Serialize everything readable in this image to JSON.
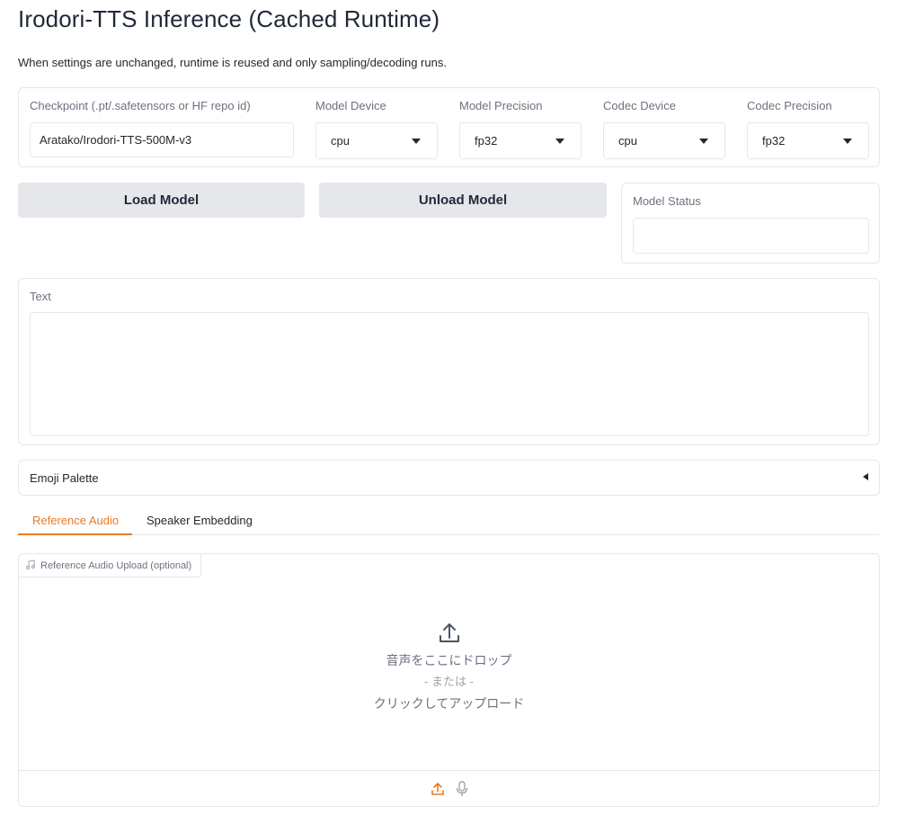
{
  "header": {
    "title": "Irodori-TTS Inference (Cached Runtime)",
    "subtitle": "When settings are unchanged, runtime is reused and only sampling/decoding runs."
  },
  "settings": {
    "checkpoint": {
      "label": "Checkpoint (.pt/.safetensors or HF repo id)",
      "value": "Aratako/Irodori-TTS-500M-v3"
    },
    "model_device": {
      "label": "Model Device",
      "value": "cpu"
    },
    "model_precision": {
      "label": "Model Precision",
      "value": "fp32"
    },
    "codec_device": {
      "label": "Codec Device",
      "value": "cpu"
    },
    "codec_precision": {
      "label": "Codec Precision",
      "value": "fp32"
    }
  },
  "actions": {
    "load_label": "Load Model",
    "unload_label": "Unload Model"
  },
  "status": {
    "label": "Model Status",
    "value": ""
  },
  "text_input": {
    "label": "Text",
    "value": ""
  },
  "emoji_palette": {
    "label": "Emoji Palette",
    "icon": "caret-left-icon"
  },
  "tabs": [
    {
      "label": "Reference Audio",
      "active": true
    },
    {
      "label": "Speaker Embedding",
      "active": false
    }
  ],
  "upload": {
    "tag_label": "Reference Audio Upload (optional)",
    "tag_icon": "music-note-icon",
    "drop_text": "音声をここにドロップ",
    "or_text": "- または -",
    "click_text": "クリックしてアップロード"
  },
  "colors": {
    "accent": "#ea7a25",
    "button_bg": "#e5e7eb",
    "border": "#e5e7eb"
  }
}
